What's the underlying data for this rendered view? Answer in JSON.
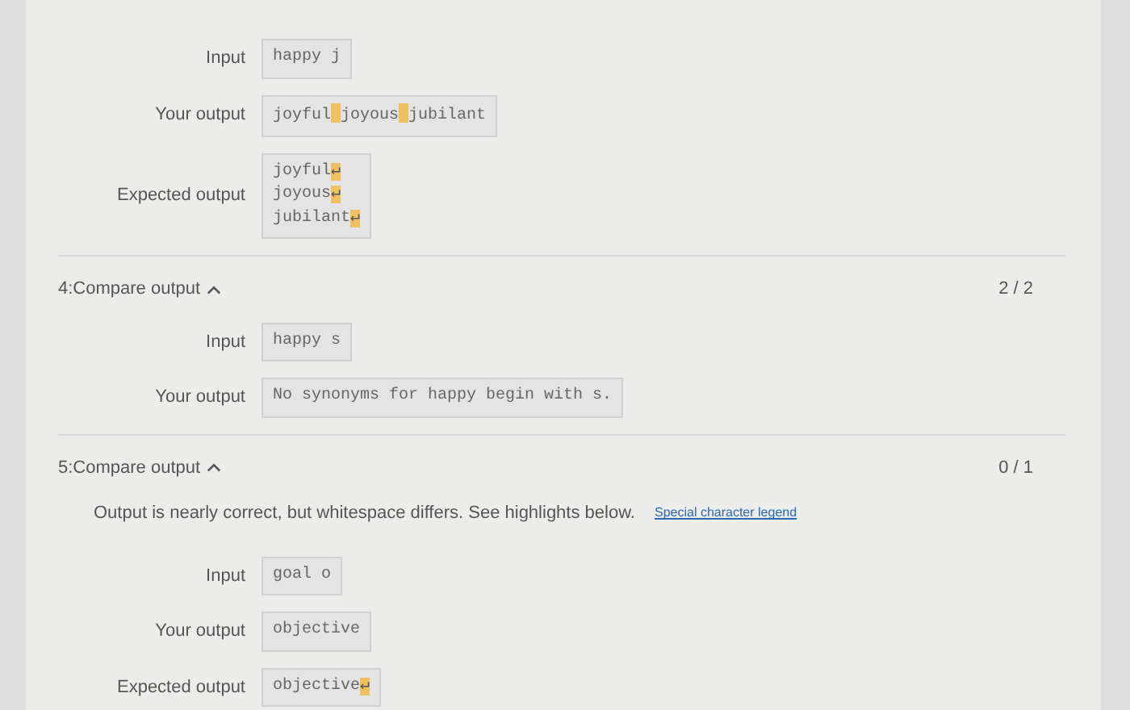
{
  "sections": [
    {
      "rows": [
        {
          "label": "Input",
          "lines": [
            [
              {
                "kind": "text",
                "text": "happy j"
              }
            ]
          ]
        },
        {
          "label": "Your output",
          "lines": [
            [
              {
                "kind": "text",
                "text": "joyful"
              },
              {
                "kind": "space"
              },
              {
                "kind": "text",
                "text": "joyous"
              },
              {
                "kind": "space"
              },
              {
                "kind": "text",
                "text": "jubilant"
              }
            ]
          ]
        },
        {
          "label": "Expected output",
          "lines": [
            [
              {
                "kind": "text",
                "text": "joyful"
              },
              {
                "kind": "newline",
                "text": "↵"
              }
            ],
            [
              {
                "kind": "text",
                "text": "joyous"
              },
              {
                "kind": "newline",
                "text": "↵"
              }
            ],
            [
              {
                "kind": "text",
                "text": "jubilant"
              },
              {
                "kind": "newline",
                "text": "↵"
              }
            ]
          ]
        }
      ]
    },
    {
      "title": "4:Compare output",
      "expanded": true,
      "score": "2 / 2",
      "rows": [
        {
          "label": "Input",
          "lines": [
            [
              {
                "kind": "text",
                "text": "happy s"
              }
            ]
          ]
        },
        {
          "label": "Your output",
          "lines": [
            [
              {
                "kind": "text",
                "text": "No synonyms for happy begin with s."
              }
            ]
          ]
        }
      ]
    },
    {
      "title": "5:Compare output",
      "expanded": true,
      "score": "0 / 1",
      "message": "Output is nearly correct, but whitespace differs. See highlights below.",
      "legend_link": "Special character legend",
      "rows": [
        {
          "label": "Input",
          "lines": [
            [
              {
                "kind": "text",
                "text": "goal o"
              }
            ]
          ]
        },
        {
          "label": "Your output",
          "lines": [
            [
              {
                "kind": "text",
                "text": "objective"
              }
            ]
          ]
        },
        {
          "label": "Expected output",
          "lines": [
            [
              {
                "kind": "text",
                "text": "objective"
              },
              {
                "kind": "newline",
                "text": "↵"
              }
            ]
          ]
        }
      ]
    }
  ]
}
